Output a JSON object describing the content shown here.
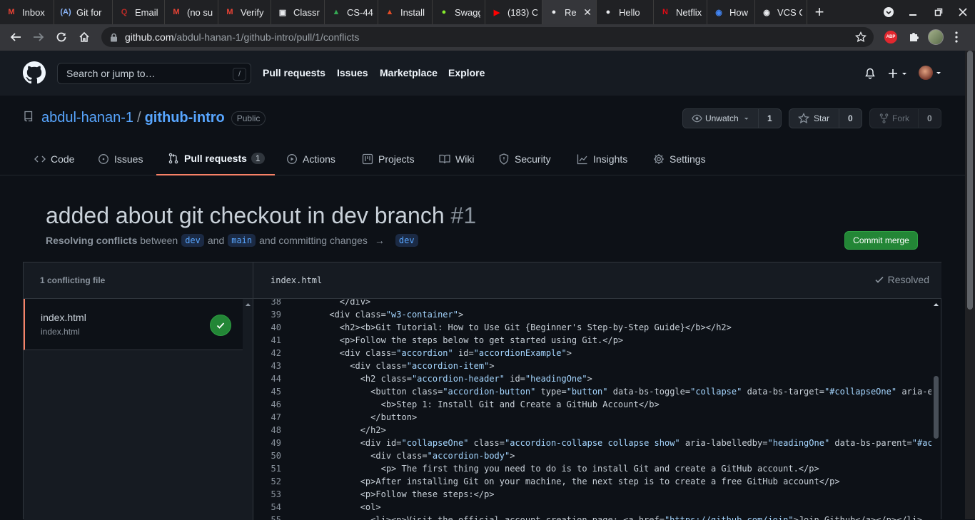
{
  "browser": {
    "tabs": [
      {
        "title": "Inbox",
        "icon": "gmail-icon",
        "color": "#ea4335",
        "glyph": "M"
      },
      {
        "title": "Git for",
        "icon": "aws-icon",
        "color": "#8ab4f8",
        "glyph": "(A)"
      },
      {
        "title": "Email",
        "icon": "quora-icon",
        "color": "#b92b27",
        "glyph": "Q"
      },
      {
        "title": "(no su",
        "icon": "gmail-icon",
        "color": "#ea4335",
        "glyph": "M"
      },
      {
        "title": "Verify",
        "icon": "gmail-icon",
        "color": "#ea4335",
        "glyph": "M"
      },
      {
        "title": "Classr",
        "icon": "classroom-icon",
        "color": "#e8eaed",
        "glyph": "▣"
      },
      {
        "title": "CS-44",
        "icon": "drive-icon",
        "color": "#34a853",
        "glyph": "▲"
      },
      {
        "title": "Install",
        "icon": "atlassian-icon",
        "color": "#e34c26",
        "glyph": "▲"
      },
      {
        "title": "Swagg",
        "icon": "swagger-icon",
        "color": "#85ea2d",
        "glyph": "●"
      },
      {
        "title": "(183) C",
        "icon": "youtube-icon",
        "color": "#ff0000",
        "glyph": "▶"
      },
      {
        "title": "Re",
        "icon": "github-icon",
        "color": "#e8eaed",
        "glyph": "●"
      },
      {
        "title": "Hello",
        "icon": "github-icon",
        "color": "#e8eaed",
        "glyph": "●"
      },
      {
        "title": "Netflix",
        "icon": "netflix-icon",
        "color": "#e50914",
        "glyph": "N"
      },
      {
        "title": "How t",
        "icon": "globe-icon",
        "color": "#4285f4",
        "glyph": "◉"
      },
      {
        "title": "VCS G",
        "icon": "globe-icon",
        "color": "#e8eaed",
        "glyph": "◉"
      }
    ],
    "url_host": "github.com",
    "url_path": "/abdul-hanan-1/github-intro/pull/1/conflicts",
    "ext_abp": "ABP"
  },
  "gh": {
    "search_placeholder": "Search or jump to…",
    "search_key": "/",
    "nav": [
      "Pull requests",
      "Issues",
      "Marketplace",
      "Explore"
    ]
  },
  "repo": {
    "owner": "abdul-hanan-1",
    "sep": "/",
    "name": "github-intro",
    "visibility": "Public",
    "unwatch_label": "Unwatch",
    "watch_count": "1",
    "star_label": "Star",
    "star_count": "0",
    "fork_label": "Fork",
    "fork_count": "0",
    "tabs": [
      "Code",
      "Issues",
      "Pull requests",
      "Actions",
      "Projects",
      "Wiki",
      "Security",
      "Insights",
      "Settings"
    ],
    "pr_count": "1"
  },
  "pr": {
    "title": "added about git checkout in dev branch",
    "number": "#1",
    "resolving": "Resolving conflicts",
    "between": "between",
    "head": "dev",
    "and": "and",
    "base": "main",
    "committing": "and committing changes",
    "arrow": "→",
    "target": "dev",
    "commit_merge": "Commit merge"
  },
  "conflicts": {
    "header": "1 conflicting file",
    "file_name": "index.html",
    "file_path": "index.html",
    "editor_file": "index.html",
    "resolved_label": "Resolved"
  },
  "code_lines": [
    {
      "n": "38",
      "segs": [
        [
          "        </div>",
          0
        ]
      ]
    },
    {
      "n": "39",
      "segs": [
        [
          "      <div class=",
          0
        ],
        [
          "\"w3-container\"",
          1
        ],
        [
          ">",
          0
        ]
      ]
    },
    {
      "n": "40",
      "segs": [
        [
          "        <h2><b>Git Tutorial: How to Use Git {Beginner's Step-by-Step Guide}</b></h2>",
          0
        ]
      ]
    },
    {
      "n": "41",
      "segs": [
        [
          "        <p>Follow the steps below to get started using Git.</p>",
          0
        ]
      ]
    },
    {
      "n": "42",
      "segs": [
        [
          "        <div class=",
          0
        ],
        [
          "\"accordion\"",
          1
        ],
        [
          " id=",
          0
        ],
        [
          "\"accordionExample\"",
          1
        ],
        [
          ">",
          0
        ]
      ]
    },
    {
      "n": "43",
      "segs": [
        [
          "          <div class=",
          0
        ],
        [
          "\"accordion-item\"",
          1
        ],
        [
          ">",
          0
        ]
      ]
    },
    {
      "n": "44",
      "segs": [
        [
          "            <h2 class=",
          0
        ],
        [
          "\"accordion-header\"",
          1
        ],
        [
          " id=",
          0
        ],
        [
          "\"headingOne\"",
          1
        ],
        [
          ">",
          0
        ]
      ]
    },
    {
      "n": "45",
      "segs": [
        [
          "              <button class=",
          0
        ],
        [
          "\"accordion-button\"",
          1
        ],
        [
          " type=",
          0
        ],
        [
          "\"button\"",
          1
        ],
        [
          " data-bs-toggle=",
          0
        ],
        [
          "\"collapse\"",
          1
        ],
        [
          " data-bs-target=",
          0
        ],
        [
          "\"#collapseOne\"",
          1
        ],
        [
          " aria-ex",
          0
        ]
      ]
    },
    {
      "n": "46",
      "segs": [
        [
          "                <b>Step 1: Install Git and Create a GitHub Account</b>",
          0
        ]
      ]
    },
    {
      "n": "47",
      "segs": [
        [
          "              </button>",
          0
        ]
      ]
    },
    {
      "n": "48",
      "segs": [
        [
          "            </h2>",
          0
        ]
      ]
    },
    {
      "n": "49",
      "segs": [
        [
          "            <div id=",
          0
        ],
        [
          "\"collapseOne\"",
          1
        ],
        [
          " class=",
          0
        ],
        [
          "\"accordion-collapse collapse show\"",
          1
        ],
        [
          " aria-labelledby=",
          0
        ],
        [
          "\"headingOne\"",
          1
        ],
        [
          " data-bs-parent=",
          0
        ],
        [
          "\"#acc",
          1
        ]
      ]
    },
    {
      "n": "50",
      "segs": [
        [
          "              <div class=",
          0
        ],
        [
          "\"accordion-body\"",
          1
        ],
        [
          ">",
          0
        ]
      ]
    },
    {
      "n": "51",
      "segs": [
        [
          "                <p> The first thing you need to do is to install Git and create a GitHub account.</p>",
          0
        ]
      ]
    },
    {
      "n": "52",
      "segs": [
        [
          "            <p>After installing Git on your machine, the next step is to create a free GitHub account</p>",
          0
        ]
      ]
    },
    {
      "n": "53",
      "segs": [
        [
          "            <p>Follow these steps:</p>",
          0
        ]
      ]
    },
    {
      "n": "54",
      "segs": [
        [
          "            <ol>",
          0
        ]
      ]
    },
    {
      "n": "55",
      "segs": [
        [
          "              <li><p>Visit the official account creation page: <a href=",
          0
        ],
        [
          "\"https://github.com/join\"",
          1
        ],
        ">Join Github</a></p></li>"
      ]
    }
  ]
}
